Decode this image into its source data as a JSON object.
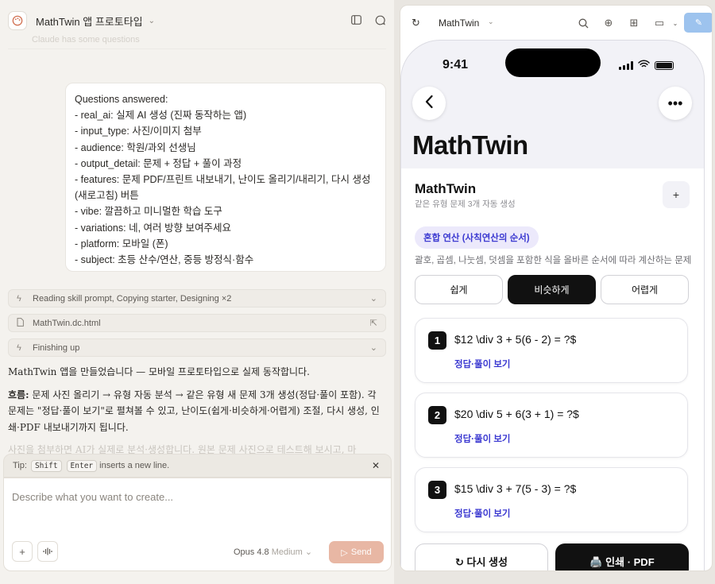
{
  "topbar": {
    "title": "MathTwin 앱 프로토타입"
  },
  "chat": {
    "faded_header": "Claude has some questions",
    "answers": [
      "Questions answered:",
      "- real_ai: 실제 AI 생성 (진짜 동작하는 앱)",
      "- input_type: 사진/이미지 첨부",
      "- audience: 학원/과외 선생님",
      "- output_detail: 문제 + 정답 + 풀이 과정",
      "- features: 문제 PDF/프린트 내보내기, 난이도 올리기/내리기, 다시 생성(새로고침) 버튼",
      "- vibe: 깔끔하고 미니멀한 학습 도구",
      "- variations: 네, 여러 방향 보여주세요",
      "- platform: 모바일 (폰)",
      "- subject: 초등 산수/연산, 중등 방정식·함수"
    ],
    "tools": {
      "reading": "Reading skill prompt, Copying starter, Designing ×2",
      "file": "MathTwin.dc.html",
      "finishing": "Finishing up"
    },
    "response": {
      "p1": "MathTwin 앱을 만들었습니다 — 모바일 프로토타입으로 실제 동작합니다.",
      "flow_label": "흐름:",
      "flow_text": " 문제 사진 올리기 → 유형 자동 분석 → 같은 유형 새 문제 3개 생성(정답·풀이 포함). 각 문제는 \"정답·풀이 보기\"로 펼쳐볼 수 있고, 난이도(쉽게·비슷하게·어렵게) 조절, 다시 생성, 인쇄·PDF 내보내기까지 됩니다.",
      "p3": "사진을 첨부하면 AI가 실제로 분석·생성합니다. 원본 문제 사진으로 테스트해 보시고, 마"
    }
  },
  "composer": {
    "tip_label": "Tip:",
    "tip_key1": "Shift",
    "tip_key2": "Enter",
    "tip_suffix": "inserts a new line.",
    "placeholder": "Describe what you want to create...",
    "model": "Opus 4.8",
    "effort": "Medium",
    "send": "Send"
  },
  "preview": {
    "app_name": "MathTwin",
    "phone": {
      "time": "9:41",
      "big_title": "MathTwin",
      "header_title": "MathTwin",
      "header_sub": "같은 유형 문제 3개 자동 생성",
      "badge": "혼합 연산 (사칙연산의 순서)",
      "description": "괄호, 곱셈, 나눗셈, 덧셈을 포함한 식을 올바른 순서에 따라 계산하는 문제",
      "difficulty": {
        "easy": "쉽게",
        "similar": "비슷하게",
        "hard": "어렵게"
      },
      "problems": [
        {
          "num": "1",
          "eq": "$12 \\div 3 + 5(6 - 2) = ?$",
          "link": "정답·풀이 보기"
        },
        {
          "num": "2",
          "eq": "$20 \\div 5 + 6(3 + 1) = ?$",
          "link": "정답·풀이 보기"
        },
        {
          "num": "3",
          "eq": "$15 \\div 3 + 7(5 - 3) = ?$",
          "link": "정답·풀이 보기"
        }
      ],
      "regen": "↻ 다시 생성",
      "print": "🖨️ 인쇄 · PDF"
    }
  }
}
